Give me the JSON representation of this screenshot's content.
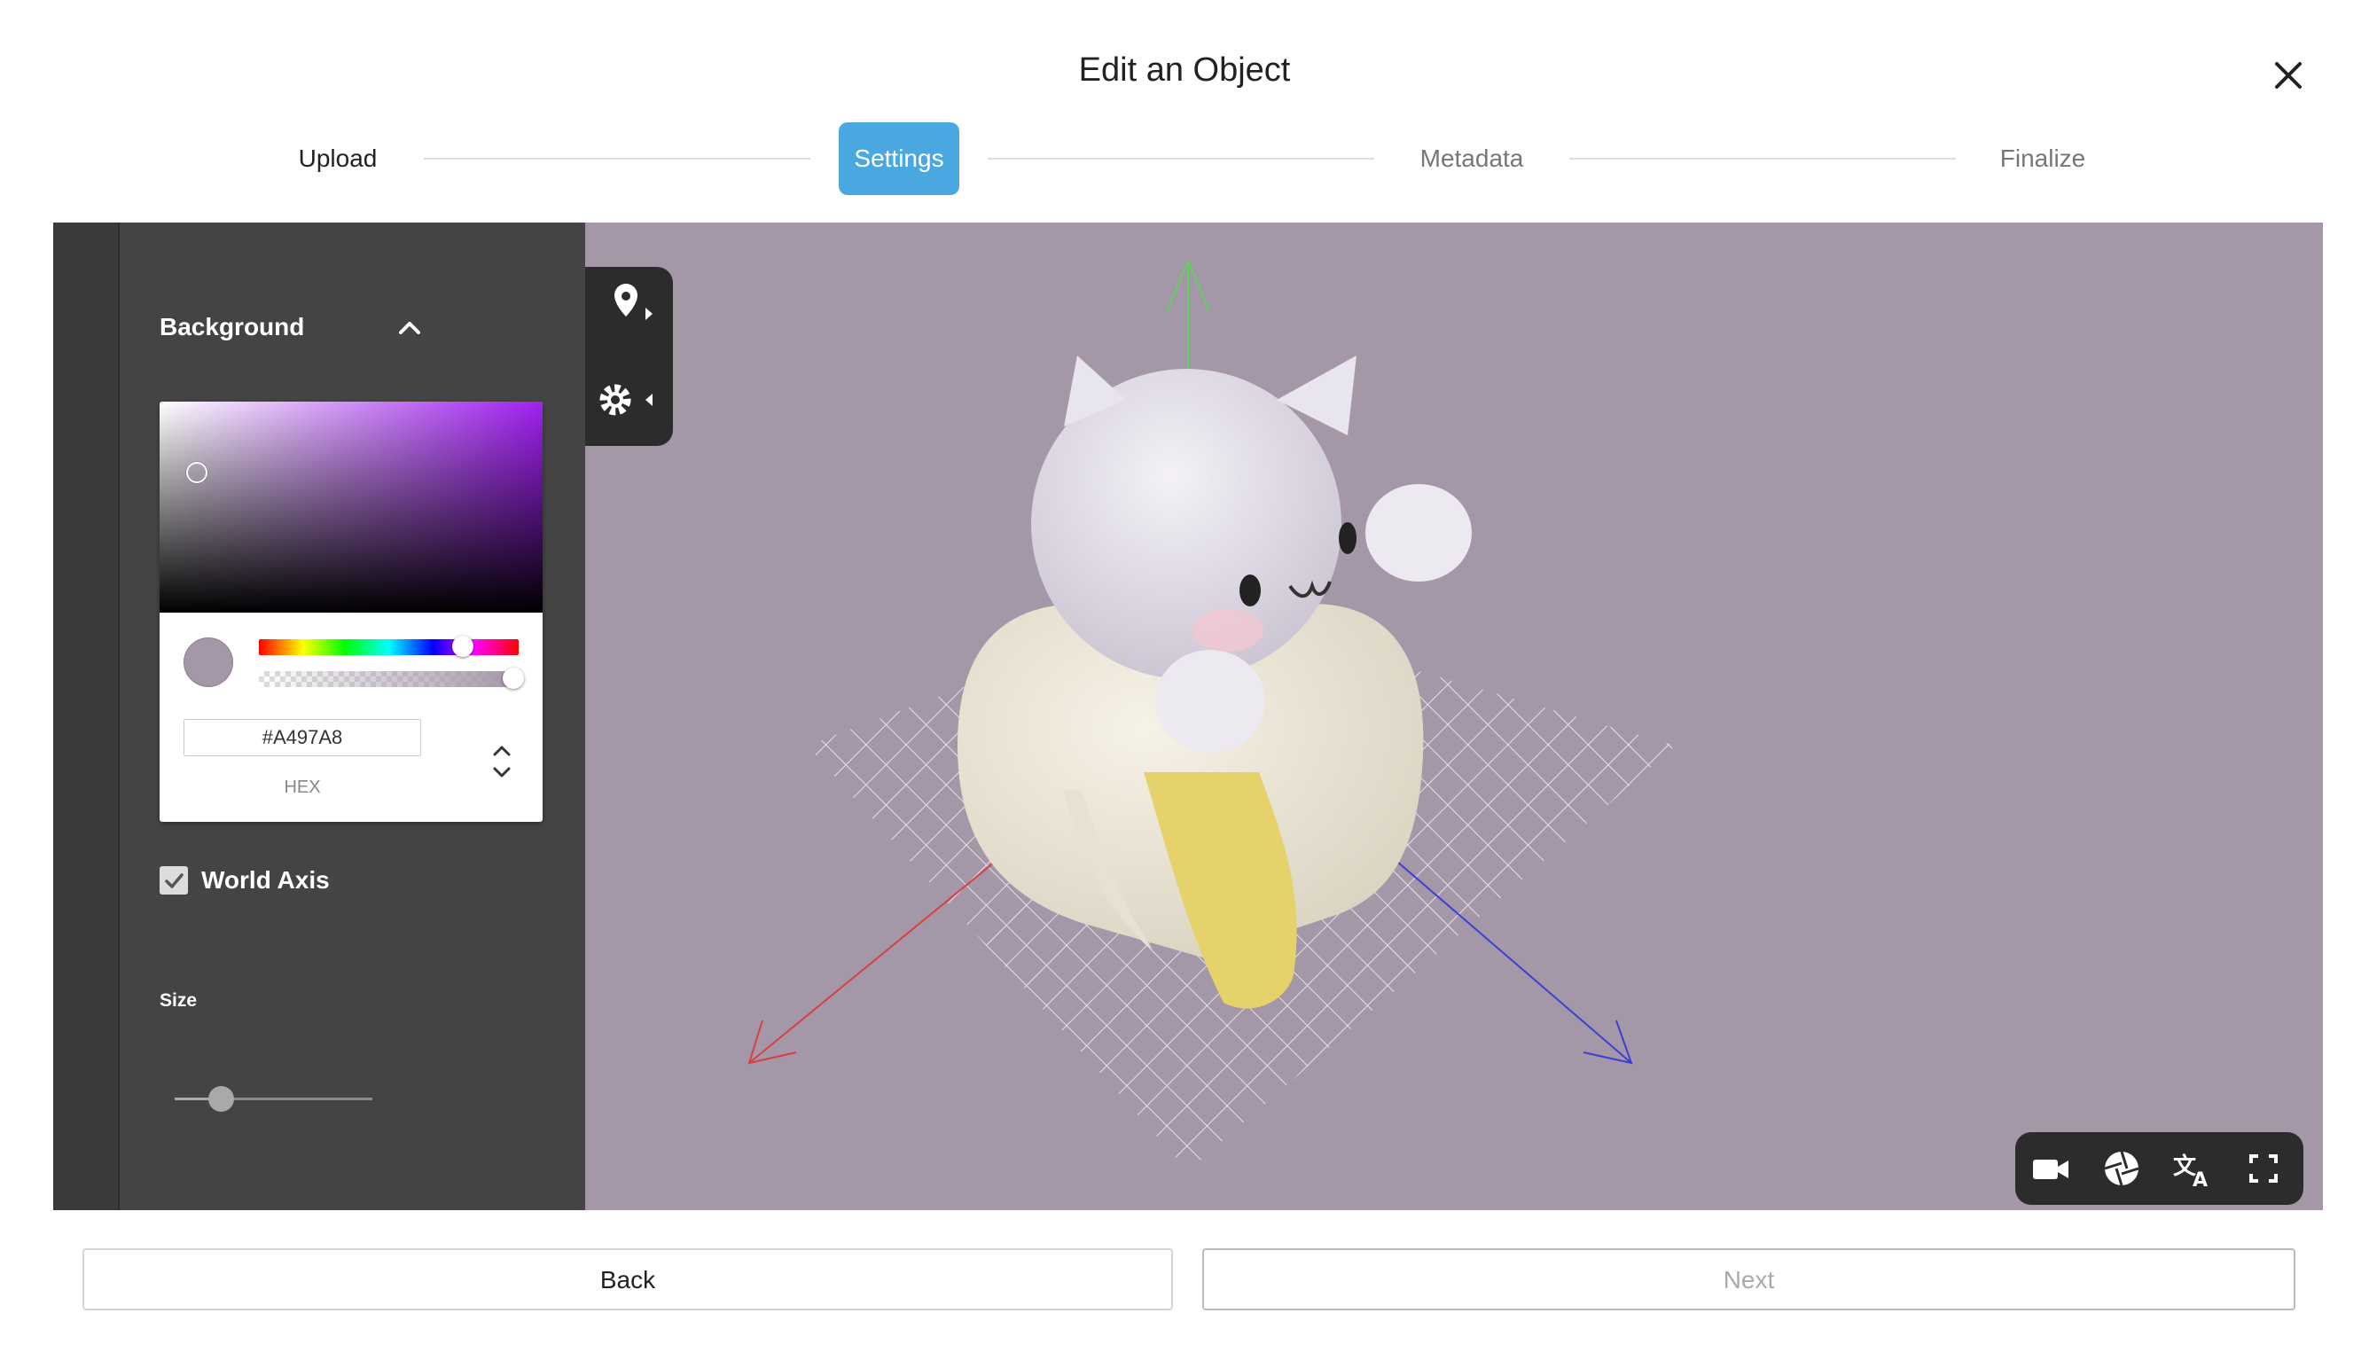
{
  "dialog": {
    "title": "Edit an Object",
    "close_icon": "close-icon"
  },
  "steps": [
    {
      "label": "Upload",
      "state": "done"
    },
    {
      "label": "Settings",
      "state": "active"
    },
    {
      "label": "Metadata",
      "state": "pending"
    },
    {
      "label": "Finalize",
      "state": "pending"
    }
  ],
  "panel": {
    "background_section": {
      "heading": "Background",
      "expanded": true,
      "color": {
        "hex_value": "#A497A8",
        "hex_label": "HEX",
        "hue_color": "#a020f0",
        "hue_position": 0.78,
        "alpha": 1.0
      }
    },
    "world_axis": {
      "label": "World Axis",
      "checked": true
    },
    "size": {
      "label": "Size",
      "value": 0.24
    }
  },
  "viewport": {
    "background": "#A497A8",
    "left_toolbar": [
      "annotation-pin-icon",
      "settings-gear-icon"
    ],
    "bottom_toolbar": [
      "camera-icon",
      "lighting-aperture-icon",
      "translate-icon",
      "fullscreen-icon"
    ]
  },
  "footer": {
    "back_label": "Back",
    "next_label": "Next"
  },
  "colors": {
    "accent": "#4aa8e0",
    "panel_bg": "#444444",
    "rail_bg": "#3a3a3a"
  }
}
